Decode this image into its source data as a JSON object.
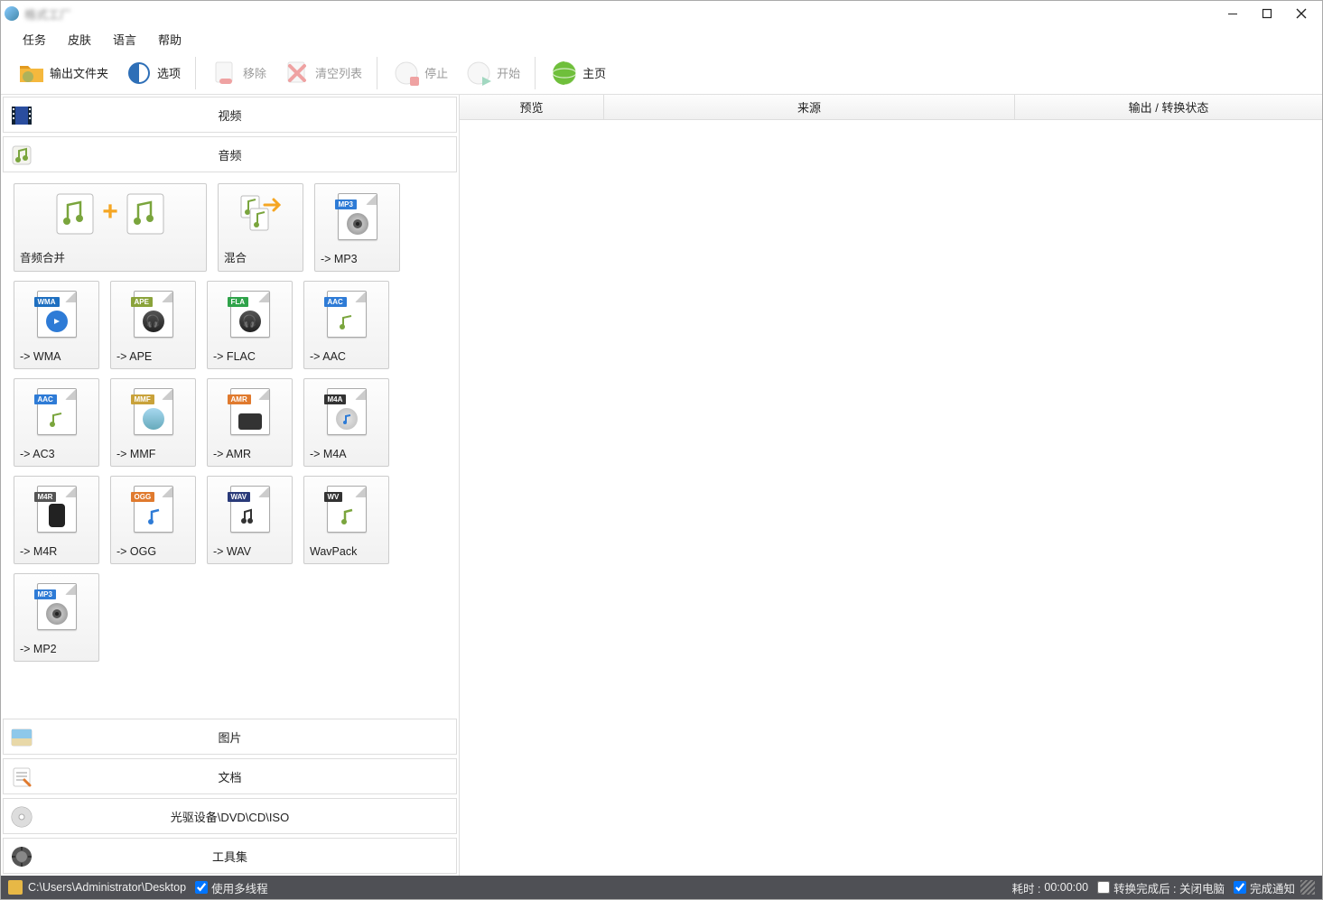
{
  "window": {
    "title": "格式工厂"
  },
  "menu": {
    "task": "任务",
    "skin": "皮肤",
    "language": "语言",
    "help": "帮助"
  },
  "toolbar": {
    "output_folder": "输出文件夹",
    "options": "选项",
    "remove": "移除",
    "clear_list": "清空列表",
    "stop": "停止",
    "start": "开始",
    "home": "主页"
  },
  "sidebar": {
    "video": "视频",
    "audio": "音频",
    "picture": "图片",
    "document": "文档",
    "disc": "光驱设备\\DVD\\CD\\ISO",
    "tools": "工具集"
  },
  "formats": {
    "audio_merge": "音频合并",
    "mix": "混合",
    "mp3": "-> MP3",
    "wma": "-> WMA",
    "ape": "-> APE",
    "flac": "-> FLAC",
    "aac": "-> AAC",
    "ac3": "-> AC3",
    "mmf": "-> MMF",
    "amr": "-> AMR",
    "m4a": "-> M4A",
    "m4r": "-> M4R",
    "ogg": "-> OGG",
    "wav": "-> WAV",
    "wavpack": "WavPack",
    "mp2": "-> MP2"
  },
  "tags": {
    "mp3": "MP3",
    "wma": "WMA",
    "ape": "APE",
    "flac": "FLA",
    "aac": "AAC",
    "ac3": "AAC",
    "mmf": "MMF",
    "amr": "AMR",
    "m4a": "M4A",
    "m4r": "M4R",
    "ogg": "OGG",
    "wav": "WAV",
    "wv": "WV",
    "mp2": "MP3"
  },
  "list": {
    "preview": "预览",
    "source": "来源",
    "output_status": "输出 / 转换状态"
  },
  "status": {
    "path": "C:\\Users\\Administrator\\Desktop",
    "multithread": "使用多线程",
    "elapsed_label": "耗时 :",
    "elapsed": "00:00:00",
    "after_done": "转换完成后 : 关闭电脑",
    "notify": "完成通知"
  }
}
